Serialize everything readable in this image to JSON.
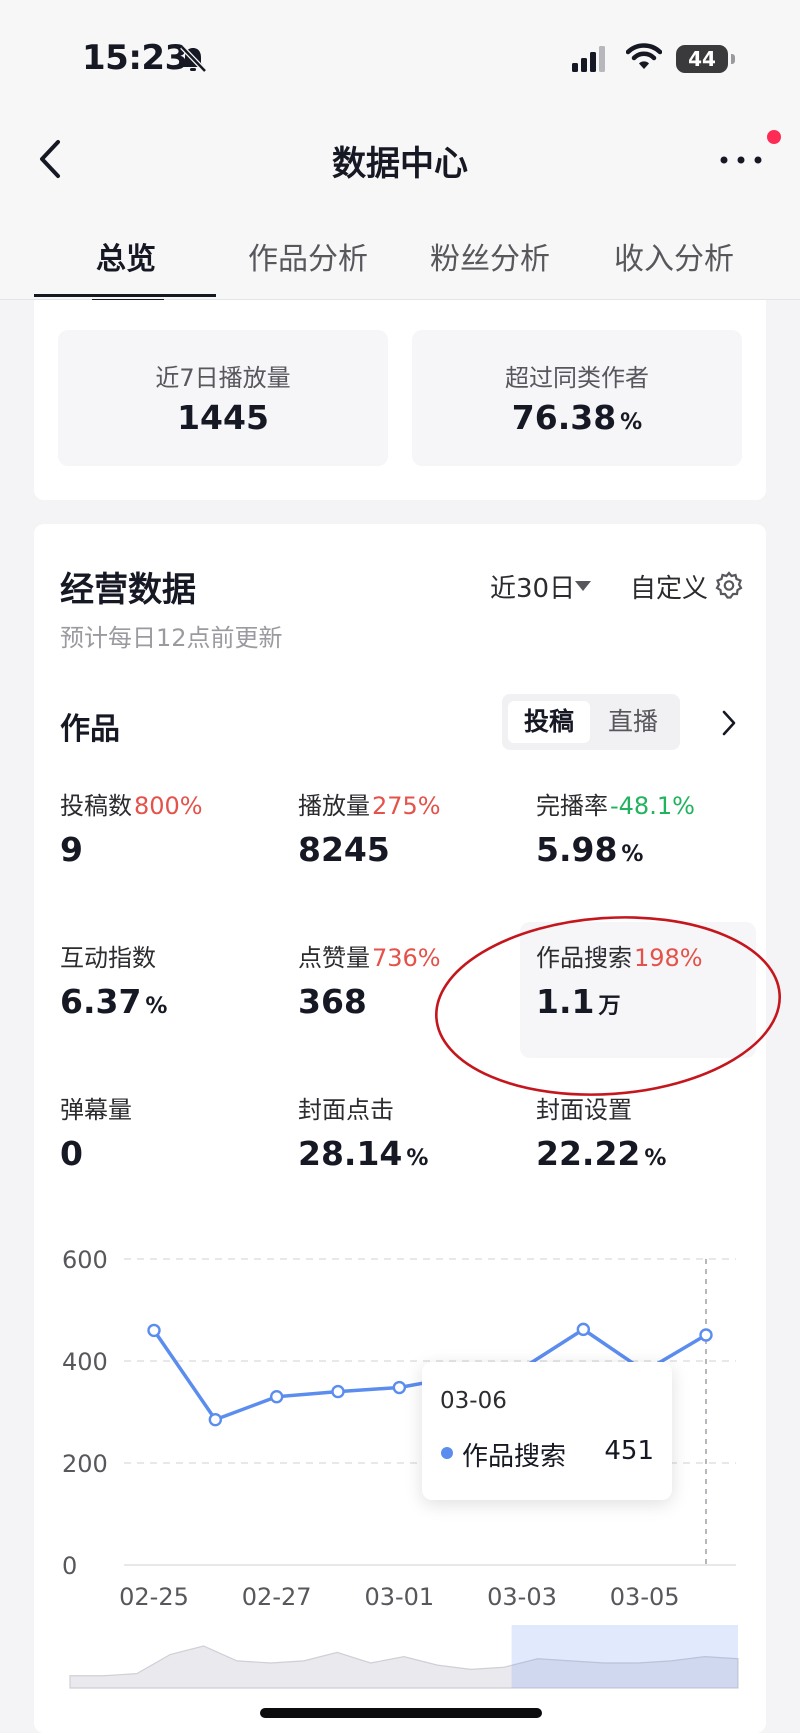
{
  "status_bar": {
    "time": "15:23",
    "battery": "44"
  },
  "nav": {
    "title": "数据中心"
  },
  "tabs": [
    {
      "label": "总览",
      "active": true
    },
    {
      "label": "作品分析",
      "active": false
    },
    {
      "label": "粉丝分析",
      "active": false
    },
    {
      "label": "收入分析",
      "active": false
    }
  ],
  "summary": [
    {
      "label": "近7日播放量",
      "value": "1445",
      "unit": ""
    },
    {
      "label": "超过同类作者",
      "value": "76.38",
      "unit": "%"
    }
  ],
  "business": {
    "title": "经营数据",
    "subtitle": "预计每日12点前更新",
    "period": "近30日",
    "custom": "自定义",
    "works_title": "作品",
    "segments": [
      {
        "label": "投稿",
        "active": true
      },
      {
        "label": "直播",
        "active": false
      }
    ],
    "metrics": [
      {
        "label": "投稿数",
        "change": "800%",
        "trend": "up",
        "value": "9",
        "unit": ""
      },
      {
        "label": "播放量",
        "change": "275%",
        "trend": "up",
        "value": "8245",
        "unit": ""
      },
      {
        "label": "完播率",
        "change": "-48.1%",
        "trend": "down",
        "value": "5.98",
        "unit": "%"
      },
      {
        "label": "互动指数",
        "change": "",
        "trend": "",
        "value": "6.37",
        "unit": "%"
      },
      {
        "label": "点赞量",
        "change": "736%",
        "trend": "up",
        "value": "368",
        "unit": ""
      },
      {
        "label": "作品搜索",
        "change": "198%",
        "trend": "up",
        "value": "1.1",
        "unit": "万",
        "selected": true
      },
      {
        "label": "弹幕量",
        "change": "",
        "trend": "",
        "value": "0",
        "unit": ""
      },
      {
        "label": "封面点击",
        "change": "",
        "trend": "",
        "value": "28.14",
        "unit": "%"
      },
      {
        "label": "封面设置",
        "change": "",
        "trend": "",
        "value": "22.22",
        "unit": "%"
      }
    ]
  },
  "colors": {
    "up": "#e4524a",
    "down": "#22b35e",
    "line": "#5b8def",
    "annotation": "#c4161c"
  },
  "chart_data": {
    "type": "line",
    "x": [
      "02-25",
      "02-26",
      "02-27",
      "02-28",
      "03-01",
      "03-02",
      "03-03",
      "03-04",
      "03-05",
      "03-06"
    ],
    "series": [
      {
        "name": "作品搜索",
        "values": [
          460,
          285,
          330,
          340,
          348,
          370,
          385,
          462,
          380,
          451
        ]
      }
    ],
    "xticks": [
      "02-25",
      "02-27",
      "03-01",
      "03-03",
      "03-05"
    ],
    "yticks": [
      "0",
      "200",
      "400",
      "600"
    ],
    "ylim": [
      0,
      600
    ],
    "grid": true,
    "tooltip": {
      "date": "03-06",
      "series": "作品搜索",
      "value": "451"
    },
    "overview": {
      "values": [
        2,
        2,
        3,
        12,
        16,
        9,
        8,
        9,
        13,
        8,
        11,
        7,
        5,
        6,
        10,
        9,
        8,
        8,
        9,
        11,
        10
      ],
      "selected_from": 0.67
    }
  }
}
